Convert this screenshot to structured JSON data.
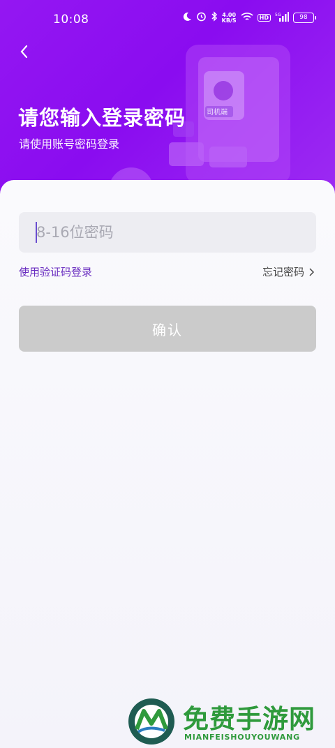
{
  "status_bar": {
    "time": "10:08",
    "net_speed_value": "4.00",
    "net_speed_unit": "KB/S",
    "hd": "HD",
    "signal": "5G",
    "battery": "98"
  },
  "header": {
    "title": "请您输入登录密码",
    "subtitle": "请使用账号密码登录",
    "illustration_label": "司机端"
  },
  "form": {
    "password_placeholder": "8-16位密码",
    "password_value": "",
    "sms_login_label": "使用验证码登录",
    "forgot_password_label": "忘记密码",
    "confirm_label": "确认"
  },
  "watermark": {
    "title": "免费手游网",
    "subtitle": "MIANFEISHOUYOUWANG"
  },
  "colors": {
    "header_purple": "#9417f2",
    "link_purple": "#6a2ec0",
    "button_disabled": "#cbcbcb"
  }
}
